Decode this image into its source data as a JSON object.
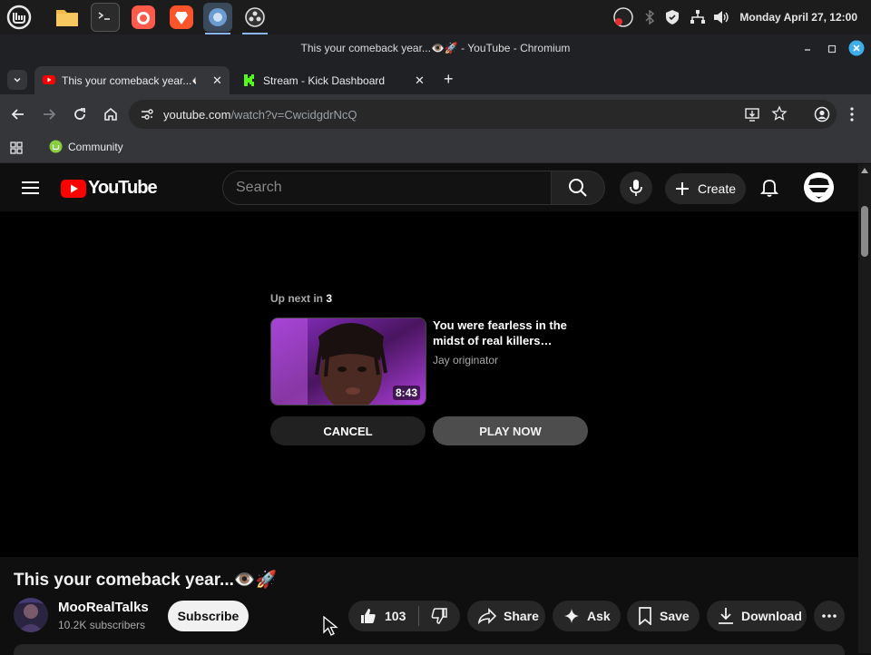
{
  "taskbar": {
    "apps": [
      "mint-menu-icon",
      "files-icon",
      "terminal-icon",
      "firefox-icon",
      "brave-icon",
      "chromium-icon",
      "obs-icon"
    ],
    "clock": "Monday April 27, 12:00"
  },
  "window": {
    "title": "This your comeback year...👁️🚀 - YouTube - Chromium"
  },
  "tabs": [
    {
      "title": "This your comeback year...👁️🚀",
      "active": true,
      "icon": "youtube-favicon"
    },
    {
      "title": "Stream - Kick Dashboard",
      "active": false,
      "icon": "kick-favicon"
    }
  ],
  "address": {
    "host": "youtube.com",
    "path": "/watch?v=CwcidgdrNcQ"
  },
  "bookmarks": [
    {
      "label": "Community",
      "icon": "community-icon"
    }
  ],
  "youtube": {
    "logo_text": "YouTube",
    "search_placeholder": "Search",
    "create_label": "Create",
    "player": {
      "upnext_prefix": "Up next in",
      "countdown": "3",
      "next_title": "You were fearless in the midst of real killers…",
      "next_channel": "Jay originator",
      "duration": "8:43",
      "cancel_label": "CANCEL",
      "play_now_label": "PLAY NOW"
    },
    "video": {
      "title": "This your comeback year...👁️🚀",
      "channel": "MooRealTalks",
      "subscribers": "10.2K subscribers",
      "subscribe_label": "Subscribe",
      "likes": "103",
      "share_label": "Share",
      "ask_label": "Ask",
      "save_label": "Save",
      "download_label": "Download"
    }
  },
  "colors": {
    "youtube_red": "#ff0000",
    "kick_green": "#53fc18",
    "accent_blue": "#8ab4f8"
  }
}
